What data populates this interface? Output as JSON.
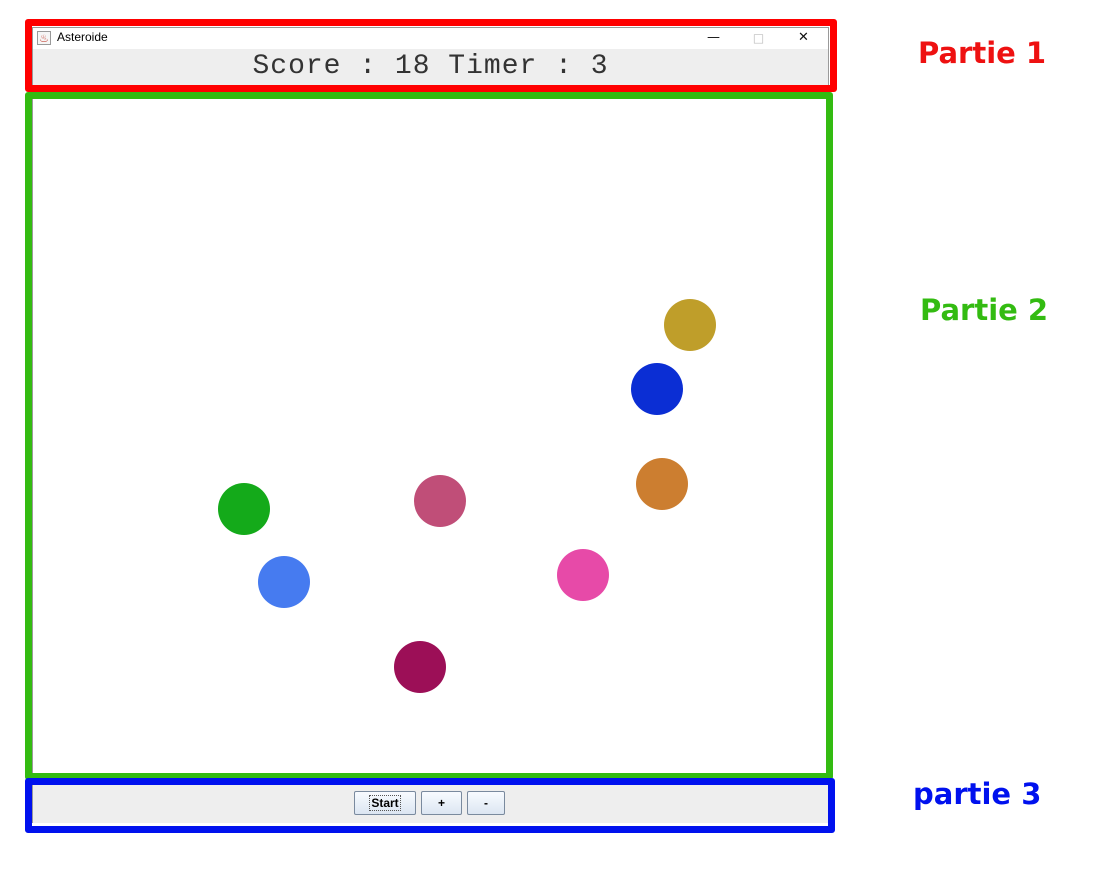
{
  "window": {
    "title": "Asteroide",
    "icon": "java-icon",
    "controls": {
      "minimize": "—",
      "maximize": "□",
      "close": "✕"
    }
  },
  "header": {
    "score_label": "Score",
    "score_value": 18,
    "timer_label": "Timer",
    "timer_value": 3,
    "text": "Score : 18 Timer : 3"
  },
  "asteroids": [
    {
      "color": "#bf9e2a"
    },
    {
      "color": "#0b2ed4"
    },
    {
      "color": "#cc7e30"
    },
    {
      "color": "#c04e78"
    },
    {
      "color": "#14aa1a"
    },
    {
      "color": "#467bf0"
    },
    {
      "color": "#e74aa8"
    },
    {
      "color": "#9c0f57"
    }
  ],
  "controls": {
    "start_label": "Start",
    "plus_label": "+",
    "minus_label": "-"
  },
  "annotations": {
    "part1": {
      "label": "Partie 1",
      "color": "#ee1111"
    },
    "part2": {
      "label": "Partie 2",
      "color": "#33bb11"
    },
    "part3": {
      "label": "partie 3",
      "color": "#0011ee"
    }
  }
}
